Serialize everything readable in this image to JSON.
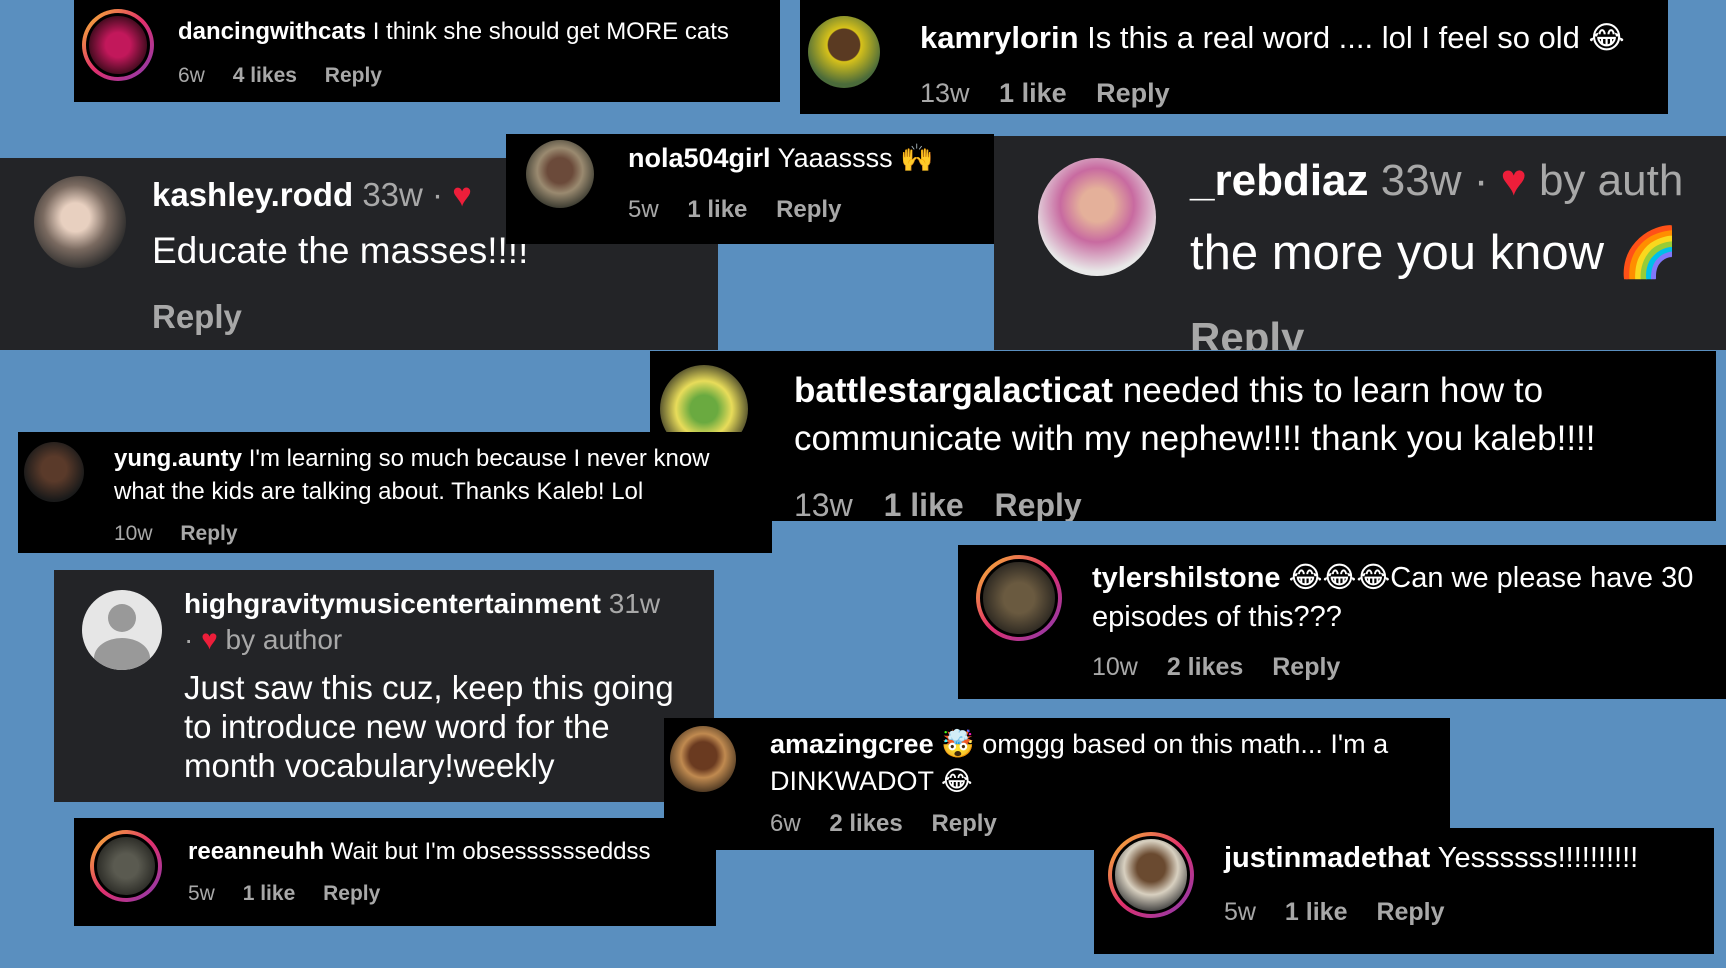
{
  "comments": {
    "dancingwithcats": {
      "username": "dancingwithcats",
      "text": "I think she should get MORE cats",
      "time": "6w",
      "likes": "4 likes",
      "reply": "Reply"
    },
    "kamrylorin": {
      "username": "kamrylorin",
      "text": "Is this a real word .... lol I feel so old 😂",
      "time": "13w",
      "likes": "1 like",
      "reply": "Reply"
    },
    "kashley": {
      "username": "kashley.rodd",
      "time": "33w",
      "dot": "·",
      "text": "Educate the masses!!!!",
      "reply": "Reply"
    },
    "nola": {
      "username": "nola504girl",
      "text": "Yaaassss 🙌",
      "time": "5w",
      "likes": "1 like",
      "reply": "Reply"
    },
    "rebdiaz": {
      "username": "_rebdiaz",
      "time": "33w",
      "dot": "·",
      "by_author": "by auth",
      "text": "the more you know 🌈",
      "reply": "Reply"
    },
    "battlestar": {
      "username": "battlestargalacticat",
      "text": "needed this to learn how to communicate with my nephew!!!! thank you kaleb!!!!",
      "time": "13w",
      "likes": "1 like",
      "reply": "Reply"
    },
    "yungaunty": {
      "username": "yung.aunty",
      "text": "I'm learning so much because I never know what the kids are talking about. Thanks Kaleb! Lol",
      "time": "10w",
      "reply": "Reply"
    },
    "tylershilstone": {
      "username": "tylershilstone",
      "text": "😂😂😂Can we please have 30 episodes of this???",
      "time": "10w",
      "likes": "2 likes",
      "reply": "Reply"
    },
    "highgravity": {
      "username": "highgravitymusicentertainment",
      "time": "31w",
      "dot": "·",
      "by_author": "by author",
      "text": "Just saw this cuz, keep this going to introduce new word for the month vocabulary!weekly"
    },
    "amazingcree": {
      "username": "amazingcree",
      "text": "🤯 omggg based on this math... I'm a DINKWADOT 😂",
      "time": "6w",
      "likes": "2 likes",
      "reply": "Reply"
    },
    "reeanneuhh": {
      "username": "reeanneuhh",
      "text": "Wait but I'm obsesssssseddss",
      "time": "5w",
      "likes": "1 like",
      "reply": "Reply"
    },
    "justinmadethat": {
      "username": "justinmadethat",
      "text": "Yessssss!!!!!!!!!!",
      "time": "5w",
      "likes": "1 like",
      "reply": "Reply"
    }
  },
  "icons": {
    "heart": "♥"
  },
  "colors": {
    "background": "#5a8fbf",
    "card_black": "#000000",
    "card_gray": "#232427",
    "heart": "#ed1e3a",
    "meta": "#a8a8a8"
  }
}
